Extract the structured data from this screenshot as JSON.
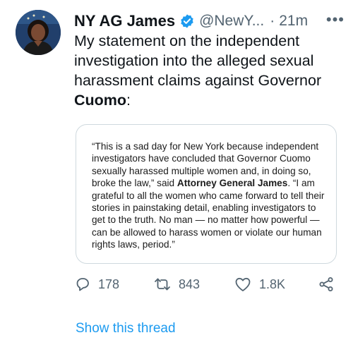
{
  "tweet": {
    "author_name": "NY AG James",
    "handle": "@NewY...",
    "separator": "·",
    "time": "21m",
    "more_label": "•••",
    "text_part1": "My statement on the independent investigation into the alleged sexual harassment claims against Governor ",
    "text_bold": "Cuomo",
    "text_part2": ":"
  },
  "quote_card": {
    "part1": "“This is a sad day for New York because independent investigators have concluded that Governor Cuomo sexually harassed multiple women and, in doing so, broke the law,” said ",
    "bold": "Attorney General James",
    "part2": ". “I am grateful to all the women who came forward to tell their stories in painstaking detail, enabling investigators to get to the truth. No man — no matter how powerful — can be allowed to harass women or violate our human rights laws, period.”"
  },
  "actions": {
    "replies": "178",
    "retweets": "843",
    "likes": "1.8K"
  },
  "show_thread": "Show this thread",
  "icons": {
    "verified": "verified-badge-icon",
    "reply": "reply-icon",
    "retweet": "retweet-icon",
    "like": "heart-icon",
    "share": "share-icon"
  },
  "colors": {
    "link": "#1d9bf0",
    "muted": "#536471",
    "text": "#0f1419",
    "card_border": "#cfd9de"
  }
}
